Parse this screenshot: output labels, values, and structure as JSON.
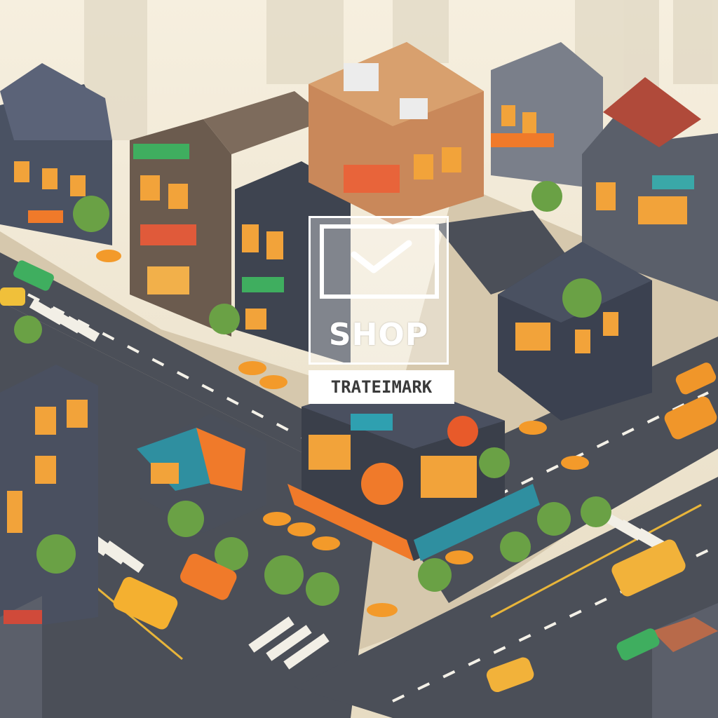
{
  "scene": {
    "description_label": "isometric-city-shop-illustration",
    "colors": {
      "road": "#4b4f58",
      "sidewalk": "#d9cdb4",
      "building_dark": "#3e4450",
      "window_glow": "#f2a33a",
      "tree": "#6aa145",
      "awning_orange": "#f07a2a",
      "awning_teal": "#2f8fa0",
      "van_orange": "#f0962a",
      "sky_haze": "#f3ead6"
    }
  },
  "logo": {
    "icon": "checkmark-monitor-icon",
    "wordmark": "SHOP",
    "tagline": "TRATEIMARK"
  }
}
